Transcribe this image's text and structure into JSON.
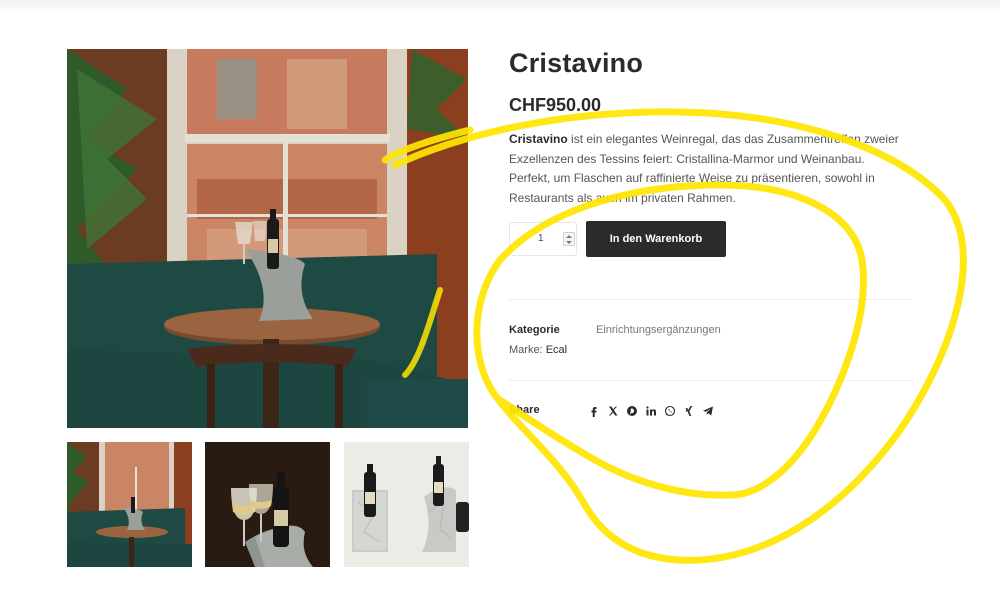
{
  "product": {
    "title": "Cristavino",
    "price": "CHF950.00",
    "description": {
      "brand": "Cristavino",
      "text": " ist ein elegantes Weinregal, das das Zusammentreffen zweier Exzellenzen des Tessins feiert: Cristallina-Marmor und Weinanbau. Perfekt, um Flaschen auf raffinierte Weise zu präsentieren, sowohl in Restaurants als auch im privaten Rahmen."
    },
    "quantity": "1",
    "add_to_cart_label": "In den Warenkorb"
  },
  "meta": {
    "category_label": "Kategorie",
    "category_value": "Einrichtungsergänzungen",
    "brand_label": "Marke:",
    "brand_value": "Ecal"
  },
  "share": {
    "label": "Share",
    "icons": [
      "facebook-icon",
      "x-twitter-icon",
      "pinterest-icon",
      "linkedin-icon",
      "whatsapp-icon",
      "xing-icon",
      "telegram-icon"
    ]
  },
  "colors": {
    "text_dark": "#2b2b2b",
    "button_bg": "#2b2b2b",
    "button_text": "#ffffff",
    "highlight_scribble": "#ffe500"
  }
}
